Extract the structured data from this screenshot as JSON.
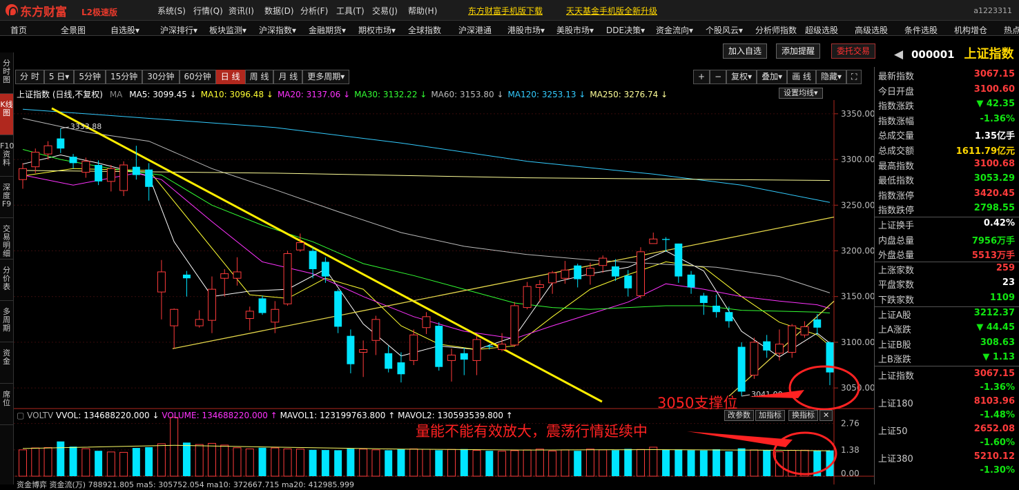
{
  "app": {
    "name": "东方财富",
    "edition": "L2极速版",
    "account": "a1223311"
  },
  "sys_menu": [
    "系统(S)",
    "行情(Q)",
    "资讯(I)",
    "数据(D)",
    "分析(F)",
    "工具(T)",
    "交易(J)",
    "帮助(H)"
  ],
  "promos": [
    "东方财富手机版下载",
    "天天基金手机版全新升级"
  ],
  "nav_menu": [
    "首页",
    "全景图",
    "自选股▾",
    "沪深排行▾",
    "板块监测▾",
    "沪深指数▾",
    "金融期货▾",
    "期权市场▾",
    "全球指数",
    "沪深港通",
    "港股市场▾",
    "美股市场▾",
    "DDE决策▾",
    "资金流向▾",
    "个股风云▾",
    "分析师指数",
    "超级选股",
    "高级选股",
    "条件选股",
    "机构增仓",
    "热点"
  ],
  "left_rail": [
    {
      "label": "分时图",
      "active": false
    },
    {
      "label": "K线图",
      "active": true
    },
    {
      "label": "F10资料",
      "active": false
    },
    {
      "label": "深度F9",
      "active": false
    },
    {
      "label": "交易明细",
      "active": false
    },
    {
      "label": "分价表",
      "active": false
    },
    {
      "label": "多周期",
      "active": false
    },
    {
      "label": "资金",
      "active": false
    },
    {
      "label": "席位",
      "active": false
    }
  ],
  "period_tabs": [
    {
      "label": "分 时",
      "active": false
    },
    {
      "label": "5 日▾",
      "active": false
    },
    {
      "label": "5分钟",
      "active": false
    },
    {
      "label": "15分钟",
      "active": false
    },
    {
      "label": "30分钟",
      "active": false
    },
    {
      "label": "60分钟",
      "active": false
    },
    {
      "label": "日 线",
      "active": true
    },
    {
      "label": "周 线",
      "active": false
    },
    {
      "label": "月 线",
      "active": false
    },
    {
      "label": "更多周期▾",
      "active": false
    }
  ],
  "chart_tools": [
    "+",
    "−",
    "复权▾",
    "叠加▾",
    "画 线",
    "隐藏▾",
    "⛶"
  ],
  "top_buttons": {
    "add_watch": "加入自选",
    "add_alert": "添加提醒",
    "trade": "委托交易"
  },
  "stock": {
    "code": "000001",
    "name": "上证指数",
    "arrow": "◀"
  },
  "ma_bar": {
    "title": "上证指数 (日线,不复权)",
    "ma_label": "MA",
    "items": [
      {
        "text": "MA5: 3099.45 ↓",
        "color": "#ffffff"
      },
      {
        "text": "MA10: 3096.48 ↓",
        "color": "#ffff33"
      },
      {
        "text": "MA20: 3137.06 ↓",
        "color": "#ff33ff"
      },
      {
        "text": "MA30: 3132.22 ↓",
        "color": "#33ff33"
      },
      {
        "text": "MA60: 3153.80 ↓",
        "color": "#bbbbbb"
      },
      {
        "text": "MA120: 3253.13 ↓",
        "color": "#33ccff"
      },
      {
        "text": "MA250: 3276.74 ↓",
        "color": "#ffff99"
      }
    ],
    "settings_button": "设置均线▾"
  },
  "quote": [
    {
      "k": "最新指数",
      "v": "3067.15",
      "c": "red"
    },
    {
      "k": "今日开盘",
      "v": "3100.60",
      "c": "red"
    },
    {
      "k": "指数涨跌",
      "v": "▼ 42.35",
      "c": "grn"
    },
    {
      "k": "指数涨幅",
      "v": "-1.36%",
      "c": "grn"
    },
    {
      "k": "总成交量",
      "v": "1.35亿手",
      "c": "wht"
    },
    {
      "k": "总成交额",
      "v": "1611.79亿元",
      "c": "yel"
    },
    {
      "k": "最高指数",
      "v": "3100.68",
      "c": "red"
    },
    {
      "k": "最低指数",
      "v": "3053.29",
      "c": "grn"
    },
    {
      "k": "指数涨停",
      "v": "3420.45",
      "c": "red"
    },
    {
      "k": "指数跌停",
      "v": "2798.55",
      "c": "grn"
    },
    {
      "k": "上证换手",
      "v": "0.42%",
      "c": "wht"
    },
    {
      "k": "内盘总量",
      "v": "7956万手",
      "c": "grn"
    },
    {
      "k": "外盘总量",
      "v": "5513万手",
      "c": "red"
    },
    {
      "k": "上涨家数",
      "v": "259",
      "c": "red"
    },
    {
      "k": "平盘家数",
      "v": "23",
      "c": "wht"
    },
    {
      "k": "下跌家数",
      "v": "1109",
      "c": "grn"
    },
    {
      "k": "上证A股",
      "v": "3212.37",
      "c": "grn"
    },
    {
      "k": "上A涨跌",
      "v": "▼ 44.45",
      "c": "grn"
    },
    {
      "k": "上证B股",
      "v": "308.63",
      "c": "grn"
    },
    {
      "k": "上B涨跌",
      "v": "▼ 1.13",
      "c": "grn"
    }
  ],
  "indices": [
    {
      "name": "上证指数",
      "value": "3067.15",
      "pct": "-1.36%"
    },
    {
      "name": "上证180",
      "value": "8103.96",
      "pct": "-1.48%"
    },
    {
      "name": "上证50",
      "value": "2652.08",
      "pct": "-1.60%"
    },
    {
      "name": "上证380",
      "value": "5210.12",
      "pct": "-1.30%"
    }
  ],
  "vol_bar": {
    "vol_label": "VOLTV",
    "vvol": "VVOL: 134688220.000 ↓",
    "volume": "VOLUME: 134688220.000 ↑",
    "mavol1": "MAVOL1: 123199763.800 ↑",
    "mavol2": "MAVOL2: 130593539.800 ↑",
    "btn_params": "改参数",
    "btn_add": "加指标",
    "btn_switch": "换指标",
    "btn_close": "✕"
  },
  "fund_bar": "资金博弈 资金流(万) 788921.805 ma5: 305752.054 ma10: 372667.715 ma20: 412985.999",
  "annotations": {
    "support": "3050支撑位",
    "volume": "量能不能有效放大，震荡行情延续中"
  },
  "chart_data": {
    "type": "candlestick",
    "ylim": [
      3035,
      3365
    ],
    "yticks": [
      "3350.00",
      "3300.00",
      "3250.00",
      "3200.00",
      "3150.00",
      "3100.00",
      "3050.00"
    ],
    "high_label": "3333.88",
    "low_label": "3041.00",
    "candles": [
      {
        "o": 3278,
        "c": 3290,
        "h": 3296,
        "l": 3268
      },
      {
        "o": 3292,
        "c": 3308,
        "h": 3312,
        "l": 3285
      },
      {
        "o": 3306,
        "c": 3315,
        "h": 3320,
        "l": 3300
      },
      {
        "o": 3323,
        "c": 3312,
        "h": 3334,
        "l": 3307
      },
      {
        "o": 3303,
        "c": 3296,
        "h": 3306,
        "l": 3290
      },
      {
        "o": 3286,
        "c": 3298,
        "h": 3302,
        "l": 3280
      },
      {
        "o": 3294,
        "c": 3276,
        "h": 3299,
        "l": 3272
      },
      {
        "o": 3276,
        "c": 3290,
        "h": 3294,
        "l": 3265
      },
      {
        "o": 3266,
        "c": 3294,
        "h": 3298,
        "l": 3260
      },
      {
        "o": 3292,
        "c": 3283,
        "h": 3315,
        "l": 3278
      },
      {
        "o": 3289,
        "c": 3270,
        "h": 3296,
        "l": 3255
      },
      {
        "o": 3155,
        "c": 3177,
        "h": 3190,
        "l": 3125
      },
      {
        "o": 3118,
        "c": 3136,
        "h": 3137,
        "l": 3093
      },
      {
        "o": 3174,
        "c": 3170,
        "h": 3178,
        "l": 3150
      },
      {
        "o": 3118,
        "c": 3125,
        "h": 3135,
        "l": 3116
      },
      {
        "o": 3124,
        "c": 3158,
        "h": 3172,
        "l": 3110
      },
      {
        "o": 3170,
        "c": 3175,
        "h": 3180,
        "l": 3150
      },
      {
        "o": 3170,
        "c": 3177,
        "h": 3193,
        "l": 3162
      },
      {
        "o": 3126,
        "c": 3134,
        "h": 3139,
        "l": 3113
      },
      {
        "o": 3148,
        "c": 3132,
        "h": 3151,
        "l": 3130
      },
      {
        "o": 3122,
        "c": 3136,
        "h": 3145,
        "l": 3110
      },
      {
        "o": 3142,
        "c": 3197,
        "h": 3200,
        "l": 3140
      },
      {
        "o": 3201,
        "c": 3209,
        "h": 3219,
        "l": 3199
      },
      {
        "o": 3200,
        "c": 3180,
        "h": 3204,
        "l": 3170
      },
      {
        "o": 3188,
        "c": 3172,
        "h": 3193,
        "l": 3165
      },
      {
        "o": 3156,
        "c": 3117,
        "h": 3158,
        "l": 3110
      },
      {
        "o": 3107,
        "c": 3076,
        "h": 3114,
        "l": 3066
      },
      {
        "o": 3089,
        "c": 3092,
        "h": 3102,
        "l": 3062
      },
      {
        "o": 3102,
        "c": 3125,
        "h": 3129,
        "l": 3086
      },
      {
        "o": 3088,
        "c": 3071,
        "h": 3096,
        "l": 3067
      },
      {
        "o": 3078,
        "c": 3065,
        "h": 3089,
        "l": 3056
      },
      {
        "o": 3080,
        "c": 3108,
        "h": 3114,
        "l": 3075
      },
      {
        "o": 3116,
        "c": 3128,
        "h": 3133,
        "l": 3109
      },
      {
        "o": 3118,
        "c": 3073,
        "h": 3122,
        "l": 3069
      },
      {
        "o": 3080,
        "c": 3086,
        "h": 3093,
        "l": 3057
      },
      {
        "o": 3088,
        "c": 3081,
        "h": 3094,
        "l": 3064
      },
      {
        "o": 3080,
        "c": 3103,
        "h": 3107,
        "l": 3064
      },
      {
        "o": 3096,
        "c": 3095,
        "h": 3098,
        "l": 3092
      },
      {
        "o": 3092,
        "c": 3098,
        "h": 3110,
        "l": 3090
      },
      {
        "o": 3097,
        "c": 3140,
        "h": 3144,
        "l": 3095
      },
      {
        "o": 3138,
        "c": 3161,
        "h": 3166,
        "l": 3136
      },
      {
        "o": 3160,
        "c": 3163,
        "h": 3168,
        "l": 3144
      },
      {
        "o": 3165,
        "c": 3176,
        "h": 3178,
        "l": 3153
      },
      {
        "o": 3170,
        "c": 3179,
        "h": 3189,
        "l": 3164
      },
      {
        "o": 3184,
        "c": 3169,
        "h": 3186,
        "l": 3160
      },
      {
        "o": 3173,
        "c": 3181,
        "h": 3187,
        "l": 3163
      },
      {
        "o": 3184,
        "c": 3192,
        "h": 3195,
        "l": 3176
      },
      {
        "o": 3183,
        "c": 3172,
        "h": 3191,
        "l": 3167
      },
      {
        "o": 3173,
        "c": 3159,
        "h": 3179,
        "l": 3150
      },
      {
        "o": 3151,
        "c": 3199,
        "h": 3204,
        "l": 3148
      },
      {
        "o": 3208,
        "c": 3213,
        "h": 3220,
        "l": 3209
      },
      {
        "o": 3213,
        "c": 3212,
        "h": 3215,
        "l": 3199
      },
      {
        "o": 3208,
        "c": 3172,
        "h": 3208,
        "l": 3165
      },
      {
        "o": 3174,
        "c": 3160,
        "h": 3178,
        "l": 3153
      },
      {
        "o": 3151,
        "c": 3143,
        "h": 3154,
        "l": 3130
      },
      {
        "o": 3140,
        "c": 3133,
        "h": 3152,
        "l": 3127
      },
      {
        "o": 3133,
        "c": 3123,
        "h": 3139,
        "l": 3116
      },
      {
        "o": 3095,
        "c": 3046,
        "h": 3100,
        "l": 3041
      },
      {
        "o": 3064,
        "c": 3100,
        "h": 3105,
        "l": 3060
      },
      {
        "o": 3101,
        "c": 3091,
        "h": 3108,
        "l": 3083
      },
      {
        "o": 3088,
        "c": 3098,
        "h": 3114,
        "l": 3080
      },
      {
        "o": 3089,
        "c": 3118,
        "h": 3120,
        "l": 3083
      },
      {
        "o": 3108,
        "c": 3117,
        "h": 3123,
        "l": 3105
      },
      {
        "o": 3125,
        "c": 3116,
        "h": 3131,
        "l": 3108
      },
      {
        "o": 3100,
        "c": 3067,
        "h": 3101,
        "l": 3053
      }
    ],
    "ma": [
      {
        "name": "MA5",
        "color": "#ffffff",
        "values": [
          [
            0,
            3295
          ],
          [
            3,
            3305
          ],
          [
            6,
            3296
          ],
          [
            10,
            3282
          ],
          [
            12,
            3210
          ],
          [
            15,
            3150
          ],
          [
            18,
            3156
          ],
          [
            21,
            3158
          ],
          [
            24,
            3180
          ],
          [
            27,
            3120
          ],
          [
            30,
            3085
          ],
          [
            33,
            3096
          ],
          [
            36,
            3092
          ],
          [
            39,
            3106
          ],
          [
            42,
            3165
          ],
          [
            45,
            3175
          ],
          [
            48,
            3182
          ],
          [
            51,
            3200
          ],
          [
            54,
            3178
          ],
          [
            57,
            3112
          ],
          [
            60,
            3084
          ],
          [
            63,
            3110
          ],
          [
            64,
            3099
          ]
        ]
      },
      {
        "name": "MA10",
        "color": "#ffff33",
        "values": [
          [
            0,
            3282
          ],
          [
            4,
            3290
          ],
          [
            10,
            3288
          ],
          [
            14,
            3220
          ],
          [
            18,
            3152
          ],
          [
            21,
            3148
          ],
          [
            24,
            3170
          ],
          [
            27,
            3158
          ],
          [
            30,
            3118
          ],
          [
            33,
            3098
          ],
          [
            36,
            3092
          ],
          [
            39,
            3096
          ],
          [
            42,
            3128
          ],
          [
            45,
            3158
          ],
          [
            48,
            3174
          ],
          [
            51,
            3188
          ],
          [
            54,
            3182
          ],
          [
            57,
            3150
          ],
          [
            60,
            3122
          ],
          [
            63,
            3108
          ],
          [
            64,
            3096
          ]
        ]
      },
      {
        "name": "MA20",
        "color": "#ff33ff",
        "values": [
          [
            0,
            3283
          ],
          [
            4,
            3272
          ],
          [
            9,
            3285
          ],
          [
            11,
            3278
          ],
          [
            15,
            3232
          ],
          [
            19,
            3188
          ],
          [
            23,
            3175
          ],
          [
            27,
            3150
          ],
          [
            31,
            3128
          ],
          [
            35,
            3112
          ],
          [
            39,
            3104
          ],
          [
            42,
            3118
          ],
          [
            45,
            3131
          ],
          [
            48,
            3144
          ],
          [
            51,
            3164
          ],
          [
            54,
            3158
          ],
          [
            57,
            3150
          ],
          [
            60,
            3145
          ],
          [
            63,
            3141
          ],
          [
            64,
            3137
          ]
        ]
      },
      {
        "name": "MA30",
        "color": "#33ff33",
        "values": [
          [
            0,
            3311
          ],
          [
            3,
            3300
          ],
          [
            7,
            3290
          ],
          [
            11,
            3283
          ],
          [
            15,
            3250
          ],
          [
            19,
            3228
          ],
          [
            23,
            3210
          ],
          [
            27,
            3186
          ],
          [
            31,
            3173
          ],
          [
            35,
            3158
          ],
          [
            39,
            3143
          ],
          [
            42,
            3138
          ],
          [
            45,
            3136
          ],
          [
            48,
            3138
          ],
          [
            51,
            3140
          ],
          [
            54,
            3140
          ],
          [
            57,
            3135
          ],
          [
            60,
            3134
          ],
          [
            63,
            3133
          ],
          [
            64,
            3132
          ]
        ]
      },
      {
        "name": "MA60",
        "color": "#bbbbbb",
        "values": [
          [
            0,
            3345
          ],
          [
            5,
            3330
          ],
          [
            10,
            3320
          ],
          [
            15,
            3290
          ],
          [
            20,
            3267
          ],
          [
            25,
            3243
          ],
          [
            30,
            3220
          ],
          [
            35,
            3205
          ],
          [
            40,
            3196
          ],
          [
            45,
            3190
          ],
          [
            50,
            3186
          ],
          [
            55,
            3182
          ],
          [
            60,
            3172
          ],
          [
            64,
            3154
          ]
        ]
      },
      {
        "name": "MA120",
        "color": "#33ccff",
        "values": [
          [
            0,
            3355
          ],
          [
            10,
            3345
          ],
          [
            20,
            3335
          ],
          [
            30,
            3318
          ],
          [
            40,
            3298
          ],
          [
            50,
            3284
          ],
          [
            57,
            3272
          ],
          [
            64,
            3253
          ]
        ]
      },
      {
        "name": "MA250",
        "color": "#ffff99",
        "values": [
          [
            0,
            3288
          ],
          [
            20,
            3285
          ],
          [
            40,
            3280
          ],
          [
            64,
            3277
          ]
        ]
      }
    ],
    "volume": {
      "ylim": [
        0,
        3.0
      ],
      "yticks": [
        "2.76",
        "1.38",
        "0.00"
      ],
      "values": [
        1.38,
        1.48,
        1.5,
        1.82,
        1.55,
        1.44,
        1.33,
        1.27,
        1.25,
        1.48,
        1.52,
        1.7,
        3.08,
        1.76,
        1.66,
        1.72,
        1.63,
        1.49,
        1.43,
        1.49,
        1.48,
        1.43,
        1.42,
        1.38,
        1.37,
        1.36,
        1.44,
        1.42,
        1.38,
        1.36,
        1.42,
        1.43,
        1.41,
        1.36,
        1.4,
        1.42,
        1.35,
        1.33,
        1.31,
        1.34,
        1.38,
        1.42,
        1.32,
        1.38,
        1.33,
        1.42,
        1.38,
        1.36,
        1.43,
        1.4,
        1.52,
        1.38,
        1.4,
        1.36,
        1.35,
        1.41,
        1.3,
        1.46,
        1.38,
        1.37,
        1.28,
        1.35,
        1.36,
        1.34,
        1.35
      ],
      "ma": [
        [
          0,
          1.45
        ],
        [
          12,
          1.62
        ],
        [
          20,
          1.52
        ],
        [
          30,
          1.42
        ],
        [
          40,
          1.37
        ],
        [
          50,
          1.39
        ],
        [
          60,
          1.36
        ],
        [
          64,
          1.33
        ]
      ]
    }
  }
}
